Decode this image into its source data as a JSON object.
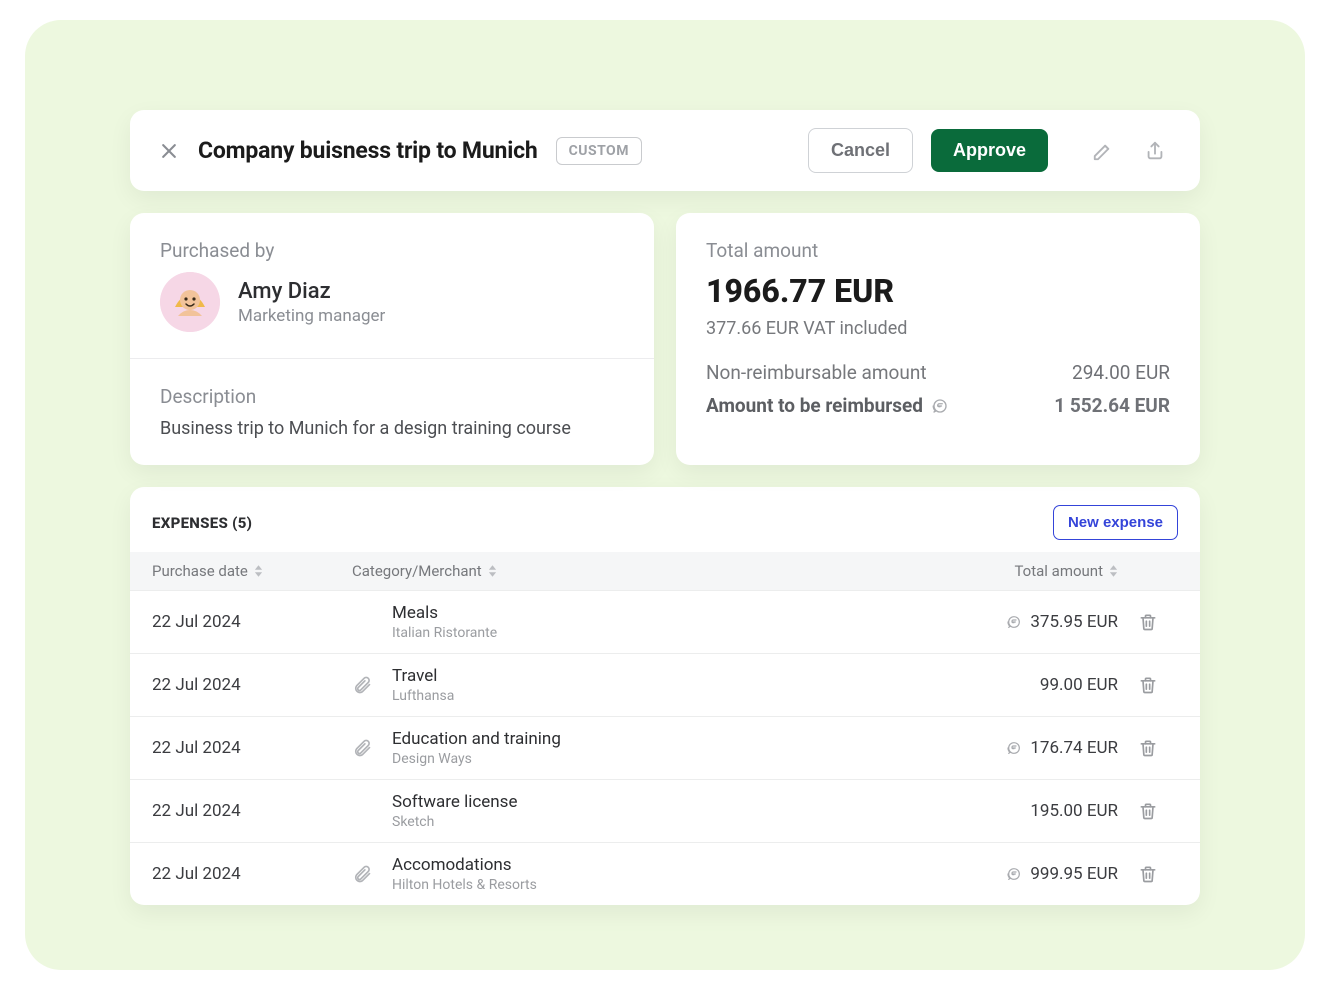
{
  "header": {
    "title": "Company buisness trip to Munich",
    "tag": "CUSTOM",
    "cancel": "Cancel",
    "approve": "Approve"
  },
  "purchaser": {
    "label": "Purchased by",
    "name": "Amy Diaz",
    "role": "Marketing manager"
  },
  "description": {
    "label": "Description",
    "text": "Business trip to Munich for a design training course"
  },
  "totals": {
    "label": "Total amount",
    "amount": "1966.77 EUR",
    "vat": "377.66 EUR VAT included",
    "non_reimb_label": "Non-reimbursable amount",
    "non_reimb_amount": "294.00 EUR",
    "reimb_label": "Amount to be reimbursed",
    "reimb_amount": "1 552.64 EUR"
  },
  "expenses": {
    "title": "EXPENSES (5)",
    "new_button": "New expense",
    "columns": {
      "date": "Purchase date",
      "category": "Category/Merchant",
      "total": "Total amount"
    },
    "rows": [
      {
        "date": "22 Jul 2024",
        "attach": false,
        "category": "Meals",
        "merchant": "Italian Ristorante",
        "reimbursable_icon": true,
        "total": "375.95 EUR"
      },
      {
        "date": "22 Jul 2024",
        "attach": true,
        "category": "Travel",
        "merchant": "Lufthansa",
        "reimbursable_icon": false,
        "total": "99.00 EUR"
      },
      {
        "date": "22 Jul 2024",
        "attach": true,
        "category": "Education and training",
        "merchant": "Design Ways",
        "reimbursable_icon": true,
        "total": "176.74 EUR"
      },
      {
        "date": "22 Jul 2024",
        "attach": false,
        "category": "Software license",
        "merchant": "Sketch",
        "reimbursable_icon": false,
        "total": "195.00 EUR"
      },
      {
        "date": "22 Jul 2024",
        "attach": true,
        "category": "Accomodations",
        "merchant": "Hilton Hotels & Resorts",
        "reimbursable_icon": true,
        "total": "999.95 EUR"
      }
    ]
  }
}
